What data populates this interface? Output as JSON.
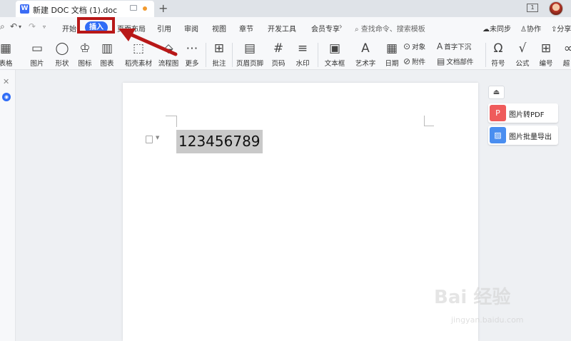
{
  "titlebar": {
    "tab_title": "新建 DOC 文档 (1).doc",
    "add_tab": "+",
    "window_count": "1"
  },
  "menu": {
    "items": [
      "开始",
      "插入",
      "页面布局",
      "引用",
      "审阅",
      "视图",
      "章节",
      "开发工具",
      "会员专享"
    ],
    "active": "插入",
    "more_arrow": "›",
    "search_placeholder": "查找命令、搜索模板",
    "sync": "未同步",
    "collab": "协作",
    "share": "分享"
  },
  "ribbon": {
    "table": "表格",
    "picture": "图片",
    "shape": "形状",
    "icon": "图标",
    "chart": "图表",
    "daoke": "稻壳素材",
    "flowchart": "流程图",
    "more": "更多",
    "comment": "批注",
    "header_footer": "页眉页脚",
    "page_number": "页码",
    "watermark": "水印",
    "textbox": "文本框",
    "wordart": "艺术字",
    "date": "日期",
    "object": "对象",
    "attachment": "附件",
    "dropcap": "首字下沉",
    "doc_parts": "文档部件",
    "symbol": "符号",
    "formula": "公式",
    "numbering": "编号",
    "hyperlink": "超"
  },
  "document": {
    "content": "123456789"
  },
  "right_panel": {
    "pic_to_pdf": "图片转PDF",
    "batch_export": "图片批量导出"
  },
  "watermark": {
    "logo": "Bai  经验",
    "url": "jingyan.baidu.com"
  },
  "colors": {
    "accent": "#2f6cf6",
    "highlight_box": "#b81818",
    "pdf_icon": "#ef5b5b",
    "export_icon": "#4a8ef0"
  }
}
